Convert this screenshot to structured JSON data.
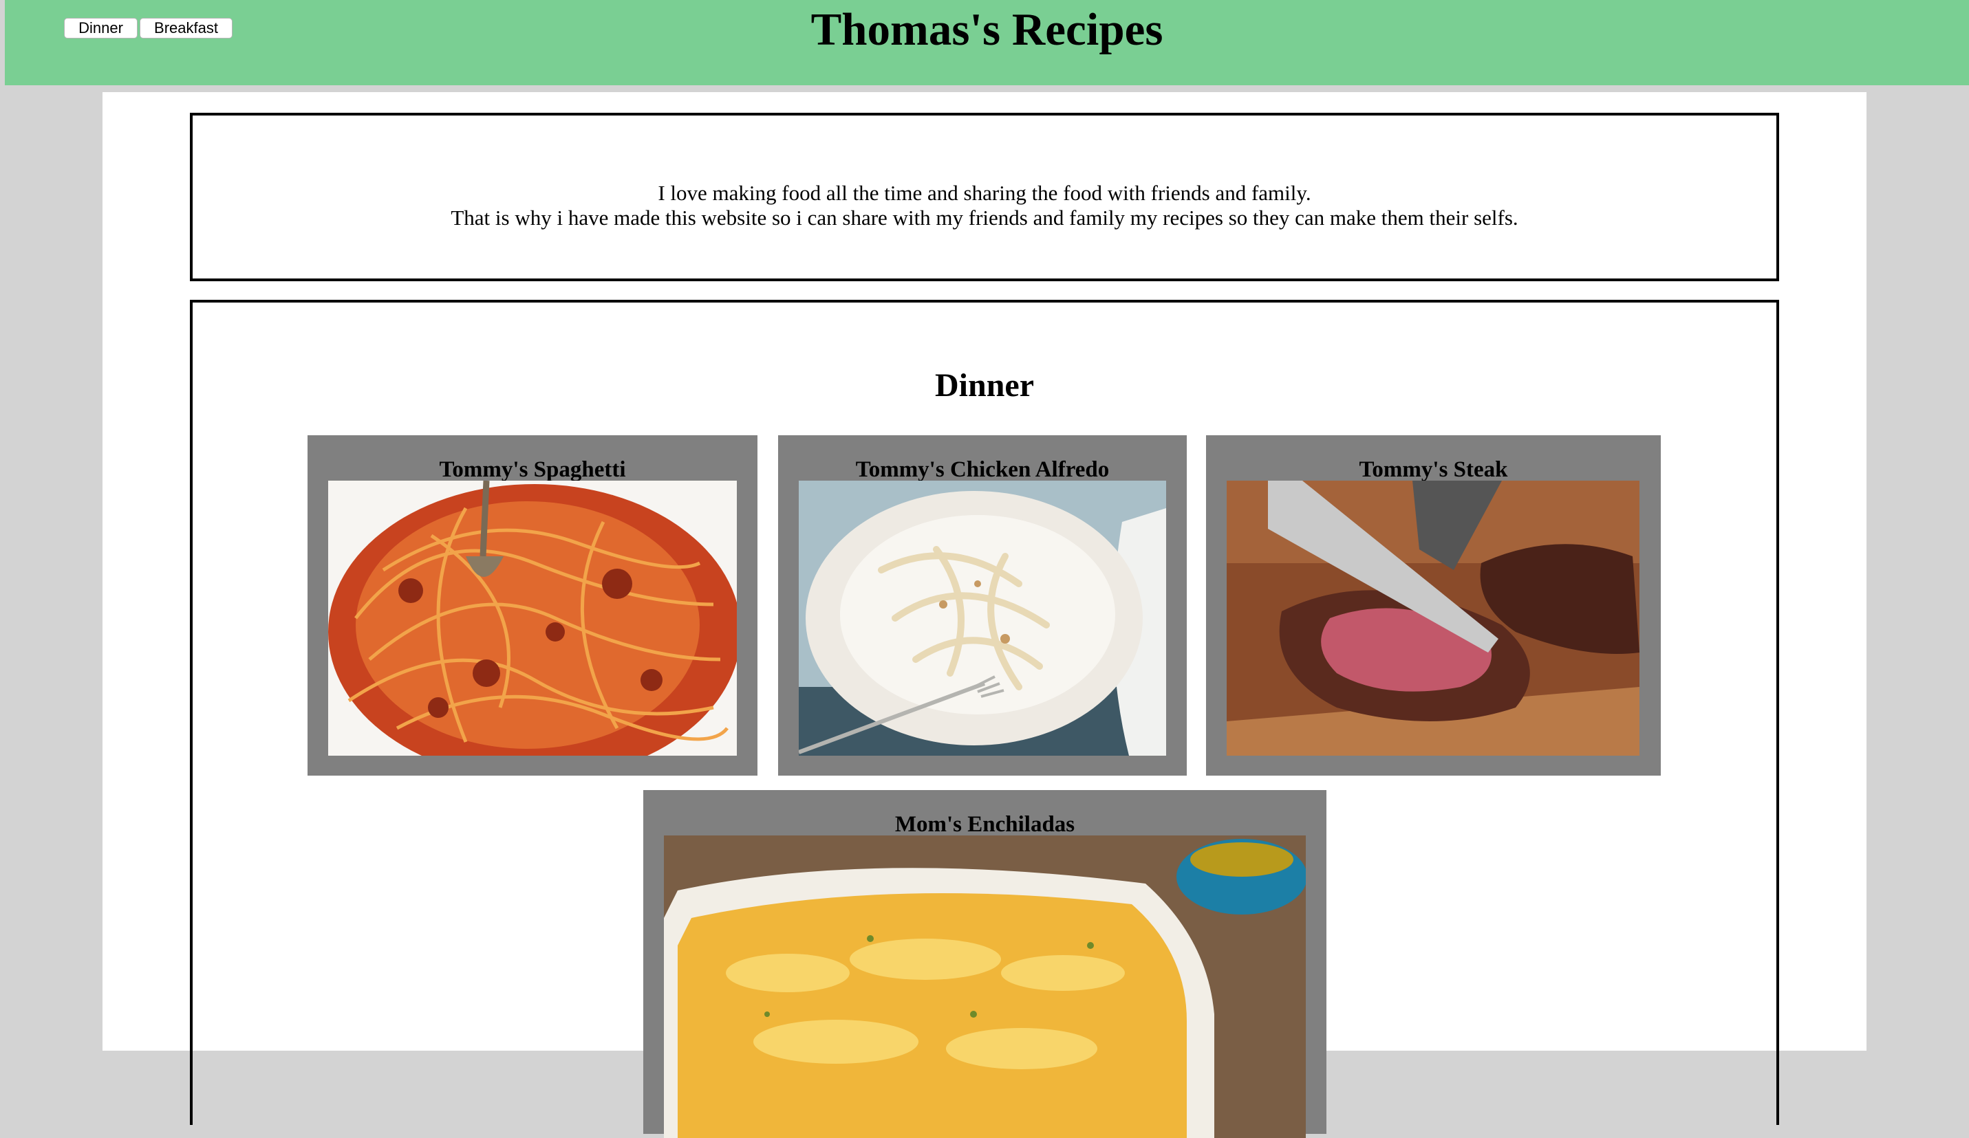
{
  "nav": {
    "dinner_label": "Dinner",
    "breakfast_label": "Breakfast"
  },
  "site": {
    "title": "Thomas's Recipes"
  },
  "intro": {
    "line1": "I love making food all the time and sharing the food with friends and family.",
    "line2": "That is why i have made this website so i can share with my friends and family my recipes so they can make them their selfs."
  },
  "dinner": {
    "heading": "Dinner",
    "recipes": [
      {
        "title": "Tommy's Spaghetti",
        "image": "spaghetti-photo"
      },
      {
        "title": "Tommy's Chicken Alfredo",
        "image": "chicken-alfredo-photo"
      },
      {
        "title": "Tommy's Steak",
        "image": "steak-photo"
      },
      {
        "title": "Mom's Enchiladas",
        "image": "enchiladas-photo"
      }
    ]
  },
  "colors": {
    "header_bg": "#7acf93",
    "page_bg": "#d3d3d3",
    "card_bg": "#808080"
  }
}
